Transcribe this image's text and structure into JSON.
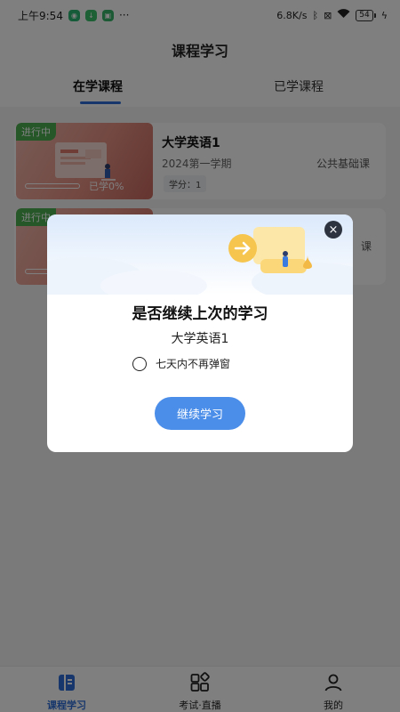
{
  "status_bar": {
    "time": "上午9:54",
    "more": "···",
    "network_speed": "6.8K/s",
    "battery": "54"
  },
  "header": {
    "title": "课程学习",
    "tabs": [
      {
        "label": "在学课程",
        "active": true
      },
      {
        "label": "已学课程",
        "active": false
      }
    ]
  },
  "courses": [
    {
      "status_tag": "进行中",
      "name": "大学英语1",
      "term": "2024第一学期",
      "type": "公共基础课",
      "credit_label": "学分：1",
      "progress_text": "已学0%",
      "progress": 0
    },
    {
      "status_tag": "进行中",
      "type_partial": "课"
    }
  ],
  "dialog": {
    "title": "是否继续上次的学习",
    "course_name": "大学英语1",
    "checkbox_label": "七天内不再弹窗",
    "continue_label": "继续学习",
    "close_icon": "×"
  },
  "bottom_nav": [
    {
      "label": "课程学习",
      "icon": "book-icon",
      "active": true
    },
    {
      "label": "考试·直播",
      "icon": "grid-icon",
      "active": false
    },
    {
      "label": "我的",
      "icon": "person-icon",
      "active": false
    }
  ],
  "colors": {
    "accent": "#2f6fd8",
    "button": "#4b8ee9",
    "status_tag": "#4caf50",
    "overlay": "rgba(0,0,0,0.5)"
  }
}
